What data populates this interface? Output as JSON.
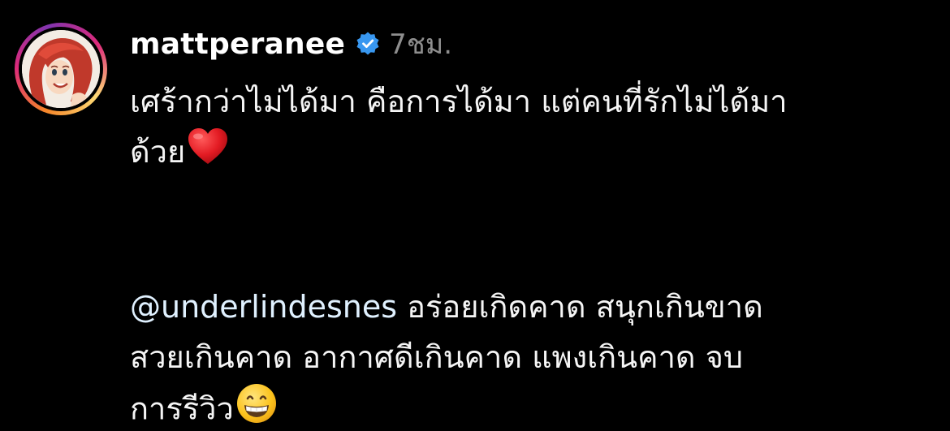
{
  "post": {
    "username": "mattperanee",
    "timestamp": "7ชม.",
    "verified_icon": "verified-badge-icon",
    "avatar_icon": "avatar-cartoon-redhead",
    "caption": {
      "line1": "เศร้ากว่าไม่ได้มา คือการได้มา แต่คนที่รักไม่ได้มา",
      "line2": "ด้วย",
      "emoji1": "red-heart-emoji",
      "mention": "@underlindesnes",
      "line3_rest": " อร่อยเกิดคาด สนุกเกินขาด",
      "line4": "สวยเกินคาด อากาศดีเกินคาด แพงเกินคาด จบ",
      "line5": "การรีวิว",
      "emoji2": "grinning-face-emoji"
    }
  },
  "colors": {
    "background": "#000000",
    "text": "#f5f5f5",
    "muted": "#8e8e8e",
    "verified": "#3897f0",
    "mention": "#e0f1ff"
  }
}
